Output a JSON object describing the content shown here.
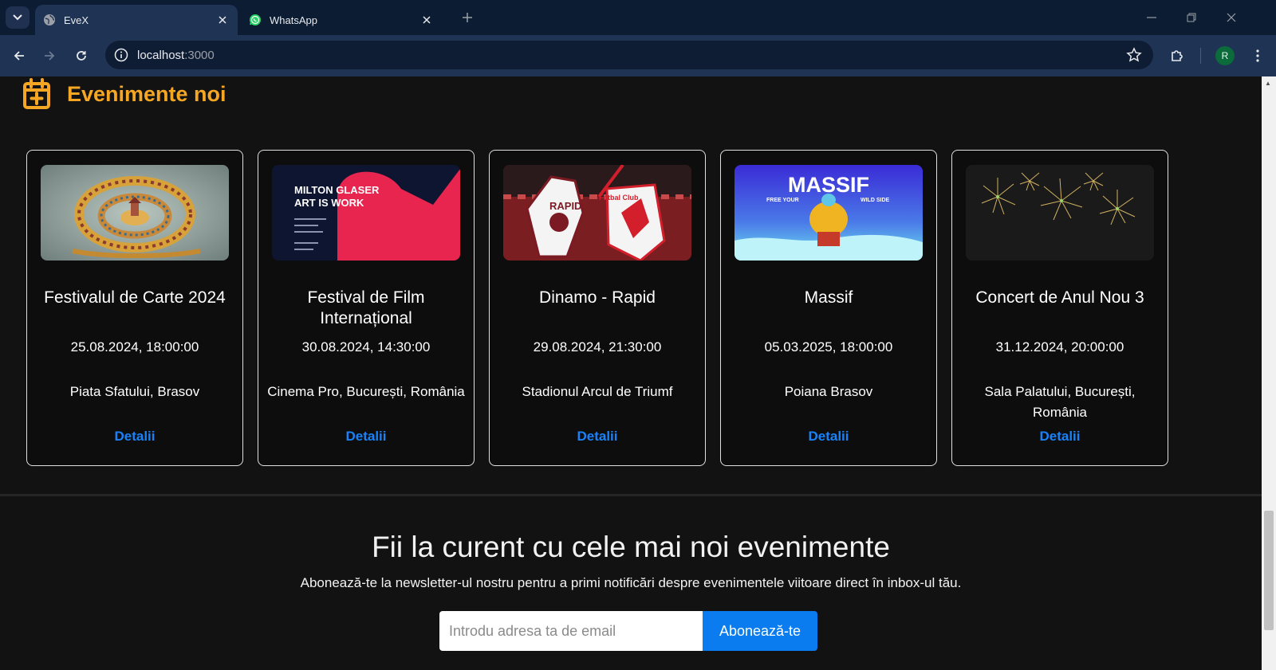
{
  "browser": {
    "tabs": [
      {
        "title": "EveX",
        "favicon": "globe-icon"
      },
      {
        "title": "WhatsApp",
        "favicon": "whatsapp-icon"
      }
    ],
    "address": {
      "host": "localhost",
      "port": ":3000"
    },
    "profile_initial": "R"
  },
  "section": {
    "title": "Evenimente noi",
    "icon": "calendar-plus-icon",
    "accent_color": "#f5a623"
  },
  "events": [
    {
      "name": "Festivalul de Carte 2024",
      "datetime": "25.08.2024, 18:00:00",
      "location": "Piata Sfatului, Brasov",
      "details_label": "Detalii"
    },
    {
      "name": "Festival de Film Internațional",
      "datetime": "30.08.2024, 14:30:00",
      "location": "Cinema Pro, București, România",
      "details_label": "Detalii",
      "poster_text": {
        "line1": "MILTON GLASER",
        "line2": "ART IS WORK"
      }
    },
    {
      "name": "Dinamo - Rapid",
      "datetime": "29.08.2024, 21:30:00",
      "location": "Stadionul Arcul de Triumf",
      "details_label": "Detalii",
      "poster_text": {
        "left_crest": "RAPID",
        "right_crest": "Fotbal Club"
      }
    },
    {
      "name": "Massif",
      "datetime": "05.03.2025, 18:00:00",
      "location": "Poiana Brasov",
      "details_label": "Detalii",
      "poster_text": {
        "brand": "MASSIF",
        "tagline_left": "FREE YOUR",
        "tagline_right": "WILD SIDE"
      }
    },
    {
      "name": "Concert de Anul Nou 3",
      "datetime": "31.12.2024, 20:00:00",
      "location": "Sala Palatului, București, România",
      "details_label": "Detalii"
    }
  ],
  "newsletter": {
    "title": "Fii la curent cu cele mai noi evenimente",
    "text": "Abonează-te la newsletter-ul nostru pentru a primi notificări despre evenimentele viitoare direct în inbox-ul tău.",
    "placeholder": "Introdu adresa ta de email",
    "button_label": "Abonează-te",
    "button_color": "#0a7cf0"
  }
}
